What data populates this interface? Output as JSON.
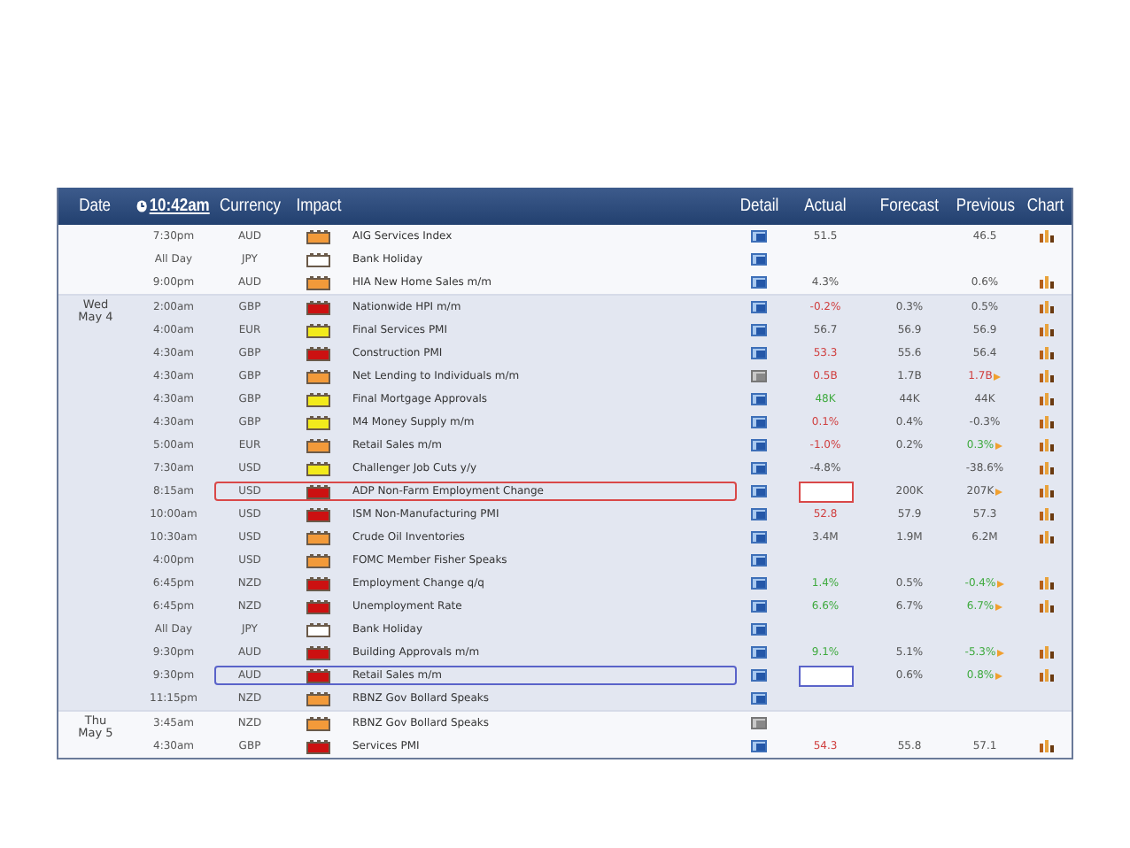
{
  "header": {
    "columns": [
      {
        "kind": "text",
        "label": "Date"
      },
      {
        "kind": "clock",
        "label": "10:42am"
      },
      {
        "kind": "text",
        "label": "Currency"
      },
      {
        "kind": "text",
        "label": "Impact"
      },
      {
        "kind": "text",
        "label": "Detail"
      },
      {
        "kind": "text",
        "label": "Actual"
      },
      {
        "kind": "text",
        "label": "Forecast"
      },
      {
        "kind": "text",
        "label": "Previous"
      },
      {
        "kind": "text",
        "label": "Chart"
      }
    ]
  },
  "days": [
    {
      "rows": [
        {
          "time": "7:30pm",
          "currency": "AUD",
          "color": "#f29a3a",
          "event": "AIG Services Index",
          "actual": {
            "text": "51.5",
            "color": "#555555"
          },
          "previous": {
            "text": "46.5",
            "color": "#555555",
            "revised": false
          },
          "chart": true
        },
        {
          "time": "All Day",
          "currency": "JPY",
          "color": "#ffffff",
          "event": "Bank Holiday",
          "chart": false
        },
        {
          "time": "9:00pm",
          "currency": "AUD",
          "color": "#f29a3a",
          "event": "HIA New Home Sales m/m",
          "actual": {
            "text": "4.3%",
            "color": "#555555"
          },
          "previous": {
            "text": "0.6%",
            "color": "#555555",
            "revised": false
          },
          "chart": true
        }
      ]
    },
    {
      "date": [
        "Wed",
        "May 4"
      ],
      "rows": [
        {
          "time": "2:00am",
          "currency": "GBP",
          "color": "#cc1111",
          "event": "Nationwide HPI m/m",
          "actual": {
            "text": "-0.2%",
            "color": "#d04040"
          },
          "forecast": "0.3%",
          "previous": {
            "text": "0.5%",
            "color": "#555555",
            "revised": false
          },
          "chart": true
        },
        {
          "time": "4:00am",
          "currency": "EUR",
          "color": "#f2ea1c",
          "event": "Final Services PMI",
          "actual": {
            "text": "56.7",
            "color": "#555555"
          },
          "forecast": "56.9",
          "previous": {
            "text": "56.9",
            "color": "#555555",
            "revised": false
          },
          "chart": true
        },
        {
          "time": "4:30am",
          "currency": "GBP",
          "color": "#cc1111",
          "event": "Construction PMI",
          "actual": {
            "text": "53.3",
            "color": "#d04040"
          },
          "forecast": "55.6",
          "previous": {
            "text": "56.4",
            "color": "#555555",
            "revised": false
          },
          "chart": true
        },
        {
          "time": "4:30am",
          "currency": "GBP",
          "color": "#f29a3a",
          "event": "Net Lending to Individuals m/m",
          "viewed": true,
          "actual": {
            "text": "0.5B",
            "color": "#d04040"
          },
          "forecast": "1.7B",
          "previous": {
            "text": "1.7B",
            "color": "#d04040",
            "revised": true
          },
          "chart": true
        },
        {
          "time": "4:30am",
          "currency": "GBP",
          "color": "#f2ea1c",
          "event": "Final Mortgage Approvals",
          "actual": {
            "text": "48K",
            "color": "#3faa3f"
          },
          "forecast": "44K",
          "previous": {
            "text": "44K",
            "color": "#555555",
            "revised": false
          },
          "chart": true
        },
        {
          "time": "4:30am",
          "currency": "GBP",
          "color": "#f2ea1c",
          "event": "M4 Money Supply m/m",
          "actual": {
            "text": "0.1%",
            "color": "#d04040"
          },
          "forecast": "0.4%",
          "previous": {
            "text": "-0.3%",
            "color": "#555555",
            "revised": false
          },
          "chart": true
        },
        {
          "time": "5:00am",
          "currency": "EUR",
          "color": "#f29a3a",
          "event": "Retail Sales m/m",
          "actual": {
            "text": "-1.0%",
            "color": "#d04040"
          },
          "forecast": "0.2%",
          "previous": {
            "text": "0.3%",
            "color": "#3faa3f",
            "revised": true
          },
          "chart": true
        },
        {
          "time": "7:30am",
          "currency": "USD",
          "color": "#f2ea1c",
          "event": "Challenger Job Cuts y/y",
          "actual": {
            "text": "-4.8%",
            "color": "#555555"
          },
          "previous": {
            "text": "-38.6%",
            "color": "#555555",
            "revised": false
          },
          "chart": true
        },
        {
          "time": "8:15am",
          "currency": "USD",
          "color": "#cc1111",
          "event": "ADP Non-Farm Employment Change",
          "frame": {
            "color": "#d94848"
          },
          "forecast": "200K",
          "previous": {
            "text": "207K",
            "color": "#555555",
            "revised": true
          },
          "chart": true
        },
        {
          "time": "10:00am",
          "currency": "USD",
          "color": "#cc1111",
          "event": "ISM Non-Manufacturing PMI",
          "actual": {
            "text": "52.8",
            "color": "#d04040"
          },
          "forecast": "57.9",
          "previous": {
            "text": "57.3",
            "color": "#555555",
            "revised": false
          },
          "chart": true
        },
        {
          "time": "10:30am",
          "currency": "USD",
          "color": "#f29a3a",
          "event": "Crude Oil Inventories",
          "actual": {
            "text": "3.4M",
            "color": "#555555"
          },
          "forecast": "1.9M",
          "previous": {
            "text": "6.2M",
            "color": "#555555",
            "revised": false
          },
          "chart": true
        },
        {
          "time": "4:00pm",
          "currency": "USD",
          "color": "#f29a3a",
          "event": "FOMC Member Fisher Speaks",
          "chart": false
        },
        {
          "time": "6:45pm",
          "currency": "NZD",
          "color": "#cc1111",
          "event": "Employment Change q/q",
          "actual": {
            "text": "1.4%",
            "color": "#3faa3f"
          },
          "forecast": "0.5%",
          "previous": {
            "text": "-0.4%",
            "color": "#3faa3f",
            "revised": true
          },
          "chart": true
        },
        {
          "time": "6:45pm",
          "currency": "NZD",
          "color": "#cc1111",
          "event": "Unemployment Rate",
          "actual": {
            "text": "6.6%",
            "color": "#3faa3f"
          },
          "forecast": "6.7%",
          "previous": {
            "text": "6.7%",
            "color": "#3faa3f",
            "revised": true
          },
          "chart": true
        },
        {
          "time": "All Day",
          "currency": "JPY",
          "color": "#ffffff",
          "event": "Bank Holiday",
          "chart": false
        },
        {
          "time": "9:30pm",
          "currency": "AUD",
          "color": "#cc1111",
          "event": "Building Approvals m/m",
          "actual": {
            "text": "9.1%",
            "color": "#3faa3f"
          },
          "forecast": "5.1%",
          "previous": {
            "text": "-5.3%",
            "color": "#3faa3f",
            "revised": true
          },
          "chart": true
        },
        {
          "time": "9:30pm",
          "currency": "AUD",
          "color": "#cc1111",
          "event": "Retail Sales m/m",
          "frame": {
            "color": "#5a63c9"
          },
          "forecast": "0.6%",
          "previous": {
            "text": "0.8%",
            "color": "#3faa3f",
            "revised": true
          },
          "chart": true
        },
        {
          "time": "11:15pm",
          "currency": "NZD",
          "color": "#f29a3a",
          "event": "RBNZ Gov Bollard Speaks",
          "chart": false
        }
      ]
    },
    {
      "date": [
        "Thu",
        "May 5"
      ],
      "rows": [
        {
          "time": "3:45am",
          "currency": "NZD",
          "color": "#f29a3a",
          "event": "RBNZ Gov Bollard Speaks",
          "viewed": true,
          "chart": false
        },
        {
          "time": "4:30am",
          "currency": "GBP",
          "color": "#cc1111",
          "event": "Services PMI",
          "actual": {
            "text": "54.3",
            "color": "#d04040"
          },
          "forecast": "55.8",
          "previous": {
            "text": "57.1",
            "color": "#555555",
            "revised": false
          },
          "chart": true
        }
      ]
    }
  ]
}
